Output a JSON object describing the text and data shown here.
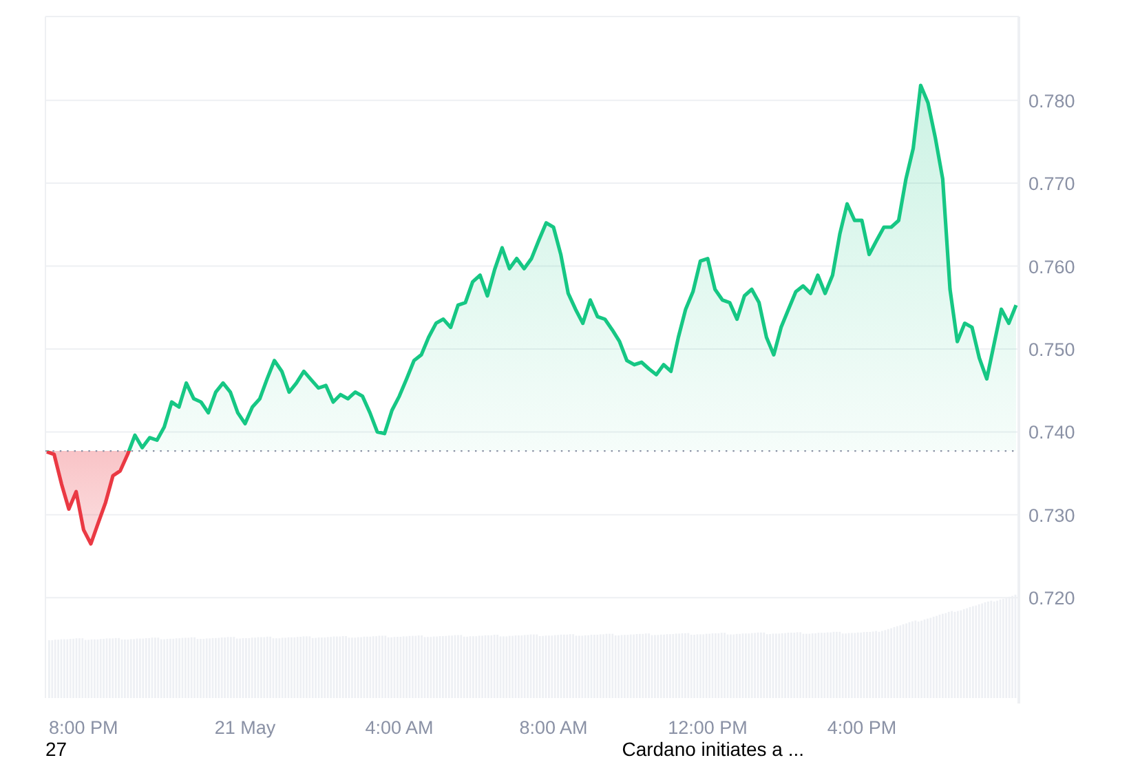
{
  "chart": {
    "chart_data": {
      "type": "area",
      "categories": [
        null,
        null,
        null,
        null,
        null,
        "8:00 PM",
        null,
        null,
        null,
        null,
        null,
        null,
        null,
        null,
        null,
        null,
        null,
        null,
        null,
        null,
        null,
        null,
        null,
        null,
        null,
        null,
        null,
        "21 May",
        null,
        null,
        null,
        null,
        null,
        null,
        null,
        null,
        null,
        null,
        null,
        null,
        null,
        null,
        null,
        null,
        null,
        null,
        null,
        null,
        "4:00 AM",
        null,
        null,
        null,
        null,
        null,
        null,
        null,
        null,
        null,
        null,
        null,
        null,
        null,
        null,
        null,
        null,
        null,
        null,
        null,
        null,
        "8:00 AM",
        null,
        null,
        null,
        null,
        null,
        null,
        null,
        null,
        null,
        null,
        null,
        null,
        null,
        null,
        null,
        null,
        null,
        null,
        null,
        null,
        "12:00 PM",
        null,
        null,
        null,
        null,
        null,
        null,
        null,
        null,
        null,
        null,
        null,
        null,
        null,
        null,
        null,
        null,
        null,
        null,
        null,
        null,
        "4:00 PM",
        null,
        null,
        null,
        null,
        null,
        null,
        null,
        null,
        null,
        null,
        null,
        null,
        null,
        null,
        null,
        null,
        null,
        null,
        null,
        null,
        null
      ],
      "series": [
        {
          "color": "#16c784",
          "values": [
            0.7376,
            0.7373,
            0.7337,
            0.7307,
            0.7328,
            0.7282,
            0.7265,
            0.729,
            0.7315,
            0.7347,
            0.7353,
            0.7373,
            0.7396,
            0.7381,
            0.7393,
            0.739,
            0.7406,
            0.7436,
            0.743,
            0.7459,
            0.744,
            0.7436,
            0.7423,
            0.7448,
            0.7459,
            0.7448,
            0.7423,
            0.741,
            0.743,
            0.744,
            0.7464,
            0.7486,
            0.7473,
            0.7448,
            0.7459,
            0.7473,
            0.7463,
            0.7453,
            0.7456,
            0.7436,
            0.7445,
            0.744,
            0.7448,
            0.7443,
            0.7423,
            0.74,
            0.7398,
            0.7426,
            0.7443,
            0.7464,
            0.7486,
            0.7493,
            0.7514,
            0.7531,
            0.7536,
            0.7526,
            0.7553,
            0.7556,
            0.7581,
            0.7589,
            0.7564,
            0.7596,
            0.7622,
            0.7597,
            0.7609,
            0.7597,
            0.7609,
            0.7631,
            0.7652,
            0.7647,
            0.7614,
            0.7567,
            0.7548,
            0.7531,
            0.7559,
            0.7539,
            0.7536,
            0.7523,
            0.7509,
            0.7486,
            0.7481,
            0.7484,
            0.7476,
            0.7469,
            0.7481,
            0.7473,
            0.7514,
            0.7548,
            0.7569,
            0.7606,
            0.7609,
            0.7572,
            0.7559,
            0.7556,
            0.7536,
            0.7564,
            0.7572,
            0.7556,
            0.7514,
            0.7493,
            0.7526,
            0.7548,
            0.7569,
            0.7576,
            0.7567,
            0.7589,
            0.7567,
            0.7589,
            0.7639,
            0.7675,
            0.7655,
            0.7655,
            0.7614,
            0.7631,
            0.7647,
            0.7647,
            0.7655,
            0.7705,
            0.7742,
            0.7818,
            0.7797,
            0.7755,
            0.7705,
            0.7572,
            0.7509,
            0.7531,
            0.7526,
            0.7489,
            0.7464,
            0.7506,
            0.7548,
            0.7531,
            0.7553
          ]
        }
      ],
      "ylim": [
        0.7079,
        0.7901
      ],
      "grid": true,
      "yticks": [
        {
          "value": 0.78,
          "label": "0.780"
        },
        {
          "value": 0.77,
          "label": "0.770"
        },
        {
          "value": 0.76,
          "label": "0.760"
        },
        {
          "value": 0.75,
          "label": "0.750"
        },
        {
          "value": 0.74,
          "label": "0.740"
        },
        {
          "value": 0.73,
          "label": "0.730"
        },
        {
          "value": 0.72,
          "label": "0.720"
        }
      ],
      "ref_lines": [
        {
          "axis": "y",
          "value": 0.7377
        }
      ]
    }
  },
  "footer": {
    "left_text": "27",
    "right_text": "Cardano initiates a ..."
  }
}
